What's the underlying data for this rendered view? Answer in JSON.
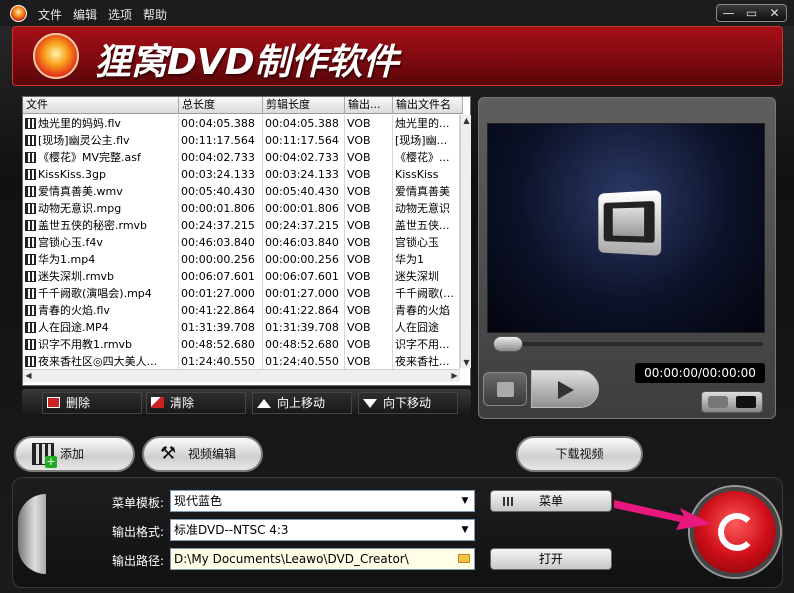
{
  "menubar": {
    "items": [
      "文件",
      "编辑",
      "选项",
      "帮助"
    ],
    "minimize": "—",
    "restore": "▭",
    "close": "✕"
  },
  "banner": {
    "title": "狸窝DVD制作软件"
  },
  "table": {
    "columns": [
      "文件",
      "总长度",
      "剪辑长度",
      "输出...",
      "输出文件名"
    ],
    "rows": [
      [
        "烛光里的妈妈.flv",
        "00:04:05.388",
        "00:04:05.388",
        "VOB",
        "烛光里的..."
      ],
      [
        "[现场]幽灵公主.flv",
        "00:11:17.564",
        "00:11:17.564",
        "VOB",
        "[现场]幽..."
      ],
      [
        "《樱花》MV完整.asf",
        "00:04:02.733",
        "00:04:02.733",
        "VOB",
        "《樱花》..."
      ],
      [
        "KissKiss.3gp",
        "00:03:24.133",
        "00:03:24.133",
        "VOB",
        "KissKiss"
      ],
      [
        "爱情真善美.wmv",
        "00:05:40.430",
        "00:05:40.430",
        "VOB",
        "爱情真善美"
      ],
      [
        "动物无意识.mpg",
        "00:00:01.806",
        "00:00:01.806",
        "VOB",
        "动物无意识"
      ],
      [
        "盖世五侠的秘密.rmvb",
        "00:24:37.215",
        "00:24:37.215",
        "VOB",
        "盖世五侠..."
      ],
      [
        "宫锁心玉.f4v",
        "00:46:03.840",
        "00:46:03.840",
        "VOB",
        "宫锁心玉"
      ],
      [
        "华为1.mp4",
        "00:00:00.256",
        "00:00:00.256",
        "VOB",
        "华为1"
      ],
      [
        "迷失深圳.rmvb",
        "00:06:07.601",
        "00:06:07.601",
        "VOB",
        "迷失深圳"
      ],
      [
        "千千阙歌(演唱会).mp4",
        "00:01:27.000",
        "00:01:27.000",
        "VOB",
        "千千阙歌(..."
      ],
      [
        "青春的火焰.flv",
        "00:41:22.864",
        "00:41:22.864",
        "VOB",
        "青春的火焰"
      ],
      [
        "人在囧途.MP4",
        "01:31:39.708",
        "01:31:39.708",
        "VOB",
        "人在囧途"
      ],
      [
        "识字不用教1.rmvb",
        "00:48:52.680",
        "00:48:52.680",
        "VOB",
        "识字不用..."
      ],
      [
        "夜来香社区◎四大美人...",
        "01:24:40.550",
        "01:24:40.550",
        "VOB",
        "夜来香社..."
      ]
    ]
  },
  "table_toolbar": {
    "delete": "删除",
    "clear": "清除",
    "move_up": "向上移动",
    "move_down": "向下移动"
  },
  "preview": {
    "time": "00:00:00/00:00:00"
  },
  "buttons": {
    "add": "添加",
    "video_edit": "视频编辑",
    "download": "下载视频"
  },
  "settings": {
    "menu_template_label": "菜单模板:",
    "menu_template_value": "现代蓝色",
    "output_format_label": "输出格式:",
    "output_format_value": "标准DVD--NTSC 4:3",
    "output_path_label": "输出路径:",
    "output_path_value": "D:\\My Documents\\Leawo\\DVD_Creator\\",
    "menu_button": "菜单",
    "open_button": "打开"
  },
  "colors": {
    "banner": "#a80f16",
    "start_button": "#d0101a",
    "arrow": "#e8187e"
  }
}
